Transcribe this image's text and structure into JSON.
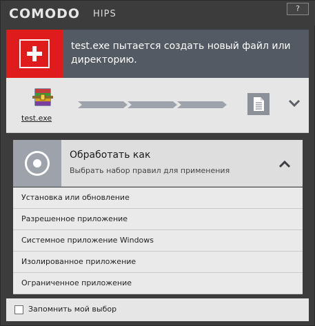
{
  "window": {
    "brand": "COMODO",
    "product": "HIPS",
    "help_label": "?"
  },
  "alert": {
    "message": "test.exe пытается создать новый файл или директорию.",
    "icon": "red-cross-alert-icon",
    "color": "#e01b1b"
  },
  "flow": {
    "app_name": "test.exe",
    "app_icon": "winrar-archive-icon",
    "target_icon": "document-icon",
    "expand_icon": "chevron-down-icon"
  },
  "treat_as": {
    "title": "Обработать как",
    "subtitle": "Выбрать набор правил для применения",
    "icon": "target-icon",
    "collapse_icon": "chevron-up-icon",
    "options": [
      "Установка или обновление",
      "Разрешенное приложение",
      "Системное приложение Windows",
      "Изолированное приложение",
      "Ограниченное приложение"
    ]
  },
  "footer": {
    "remember_label": "Запомнить мой выбор",
    "remember_checked": false
  }
}
